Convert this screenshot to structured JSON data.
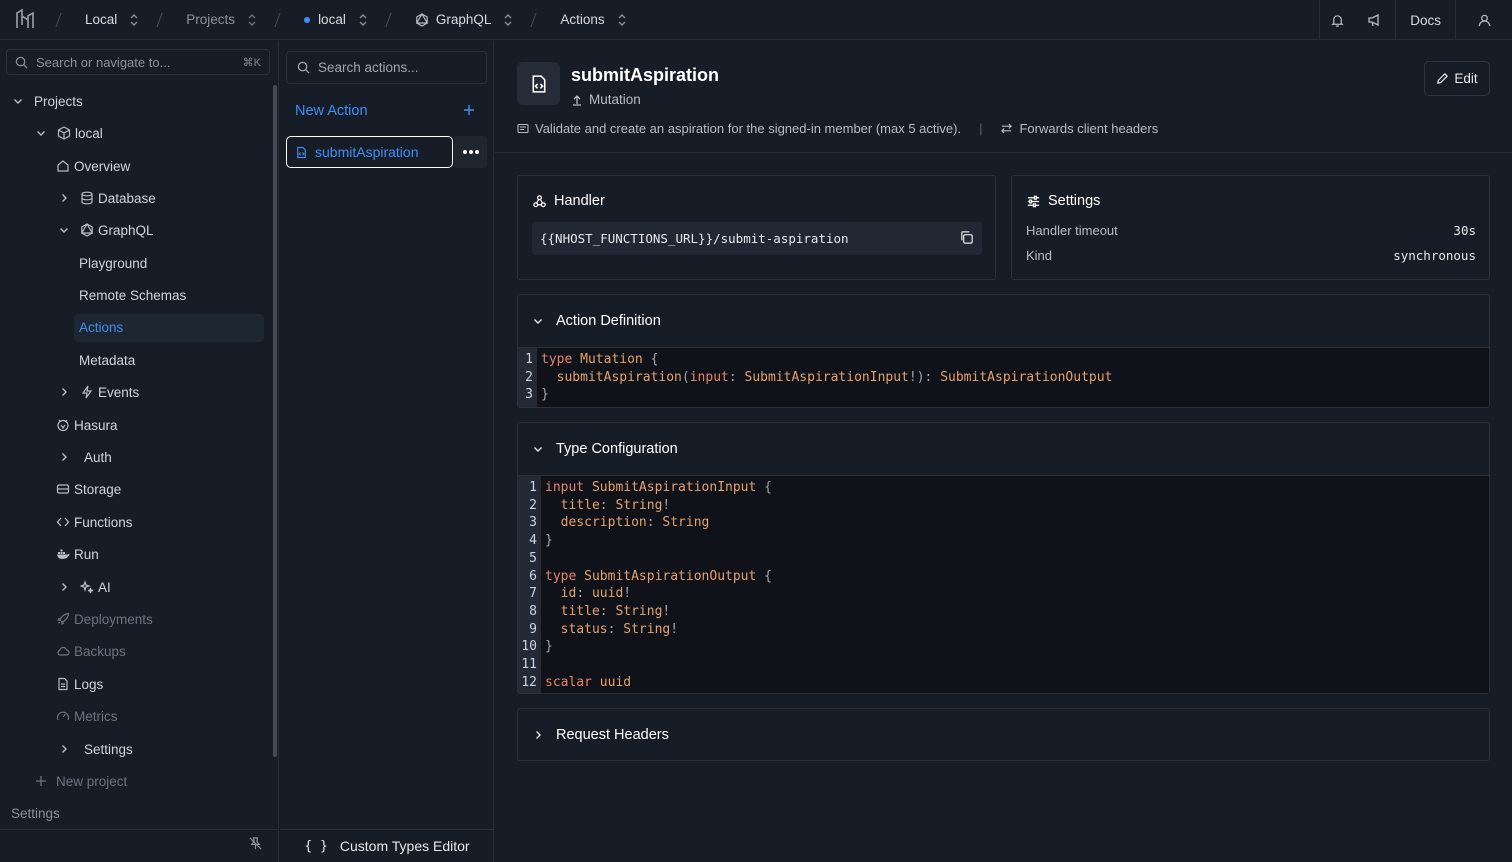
{
  "topbar": {
    "crumbs": [
      {
        "label": "Local"
      },
      {
        "label": "Projects"
      },
      {
        "label": "local"
      },
      {
        "label": "GraphQL"
      },
      {
        "label": "Actions"
      }
    ],
    "docs_label": "Docs"
  },
  "sidebar": {
    "search_placeholder": "Search or navigate to...",
    "search_shortcut": "⌘K",
    "projects_label": "Projects",
    "project_name": "local",
    "items": {
      "overview": "Overview",
      "database": "Database",
      "graphql": "GraphQL",
      "playground": "Playground",
      "remote_schemas": "Remote Schemas",
      "actions": "Actions",
      "metadata": "Metadata",
      "events": "Events",
      "hasura": "Hasura",
      "auth": "Auth",
      "storage": "Storage",
      "functions": "Functions",
      "run": "Run",
      "ai": "AI",
      "deployments": "Deployments",
      "backups": "Backups",
      "logs": "Logs",
      "metrics": "Metrics",
      "settings": "Settings"
    },
    "new_project": "New project",
    "footer_settings": "Settings"
  },
  "actions_panel": {
    "search_placeholder": "Search actions...",
    "new_action": "New Action",
    "items": [
      "submitAspiration"
    ],
    "custom_types_editor": "Custom Types Editor",
    "custom_types_icon": "{ }"
  },
  "header": {
    "title": "submitAspiration",
    "kind": "Mutation",
    "edit_label": "Edit",
    "description": "Validate and create an aspiration for the signed-in member (max 5 active).",
    "separator": "|",
    "forwards": "Forwards client headers"
  },
  "handler": {
    "title": "Handler",
    "url": "{{NHOST_FUNCTIONS_URL}}/submit-aspiration"
  },
  "settings": {
    "title": "Settings",
    "rows": [
      {
        "label": "Handler timeout",
        "value": "30s"
      },
      {
        "label": "Kind",
        "value": "synchronous"
      }
    ]
  },
  "action_definition": {
    "title": "Action Definition",
    "line_numbers": [
      "1",
      "2",
      "3"
    ]
  },
  "type_configuration": {
    "title": "Type Configuration",
    "line_numbers": [
      "1",
      "2",
      "3",
      "4",
      "5",
      "6",
      "7",
      "8",
      "9",
      "10",
      "11",
      "12"
    ]
  },
  "request_headers": {
    "title": "Request Headers"
  }
}
